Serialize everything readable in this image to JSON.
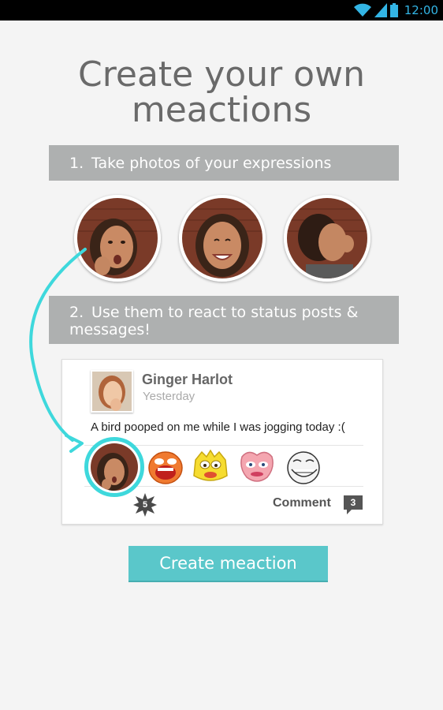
{
  "status_bar": {
    "time": "12:00",
    "icons": [
      "wifi-icon",
      "signal-icon",
      "battery-icon"
    ],
    "icon_color": "#33b5e5"
  },
  "headline": {
    "line1": "Create your own",
    "line2": "meactions"
  },
  "steps": [
    {
      "number": "1.",
      "text": "Take photos of your expressions"
    },
    {
      "number": "2.",
      "text": "Use them to react to status posts & messages!"
    }
  ],
  "expression_photos": [
    "surprised-expression-photo",
    "smiling-expression-photo",
    "disgusted-expression-photo"
  ],
  "post": {
    "author": "Ginger Harlot",
    "time": "Yesterday",
    "text": "A bird pooped on me while I was jogging today :(",
    "reactions": [
      "user-meaction",
      "orange-face-sticker",
      "yellow-face-sticker",
      "pink-face-sticker",
      "troll-face-sticker"
    ],
    "reaction_badge_count": "5",
    "comment_label": "Comment",
    "comment_count": "3"
  },
  "button": {
    "label": "Create meaction"
  },
  "colors": {
    "accent": "#3ed8dc",
    "button": "#5ac7ca",
    "banner": "#aeb0b0",
    "headline": "#6a6a6a"
  }
}
